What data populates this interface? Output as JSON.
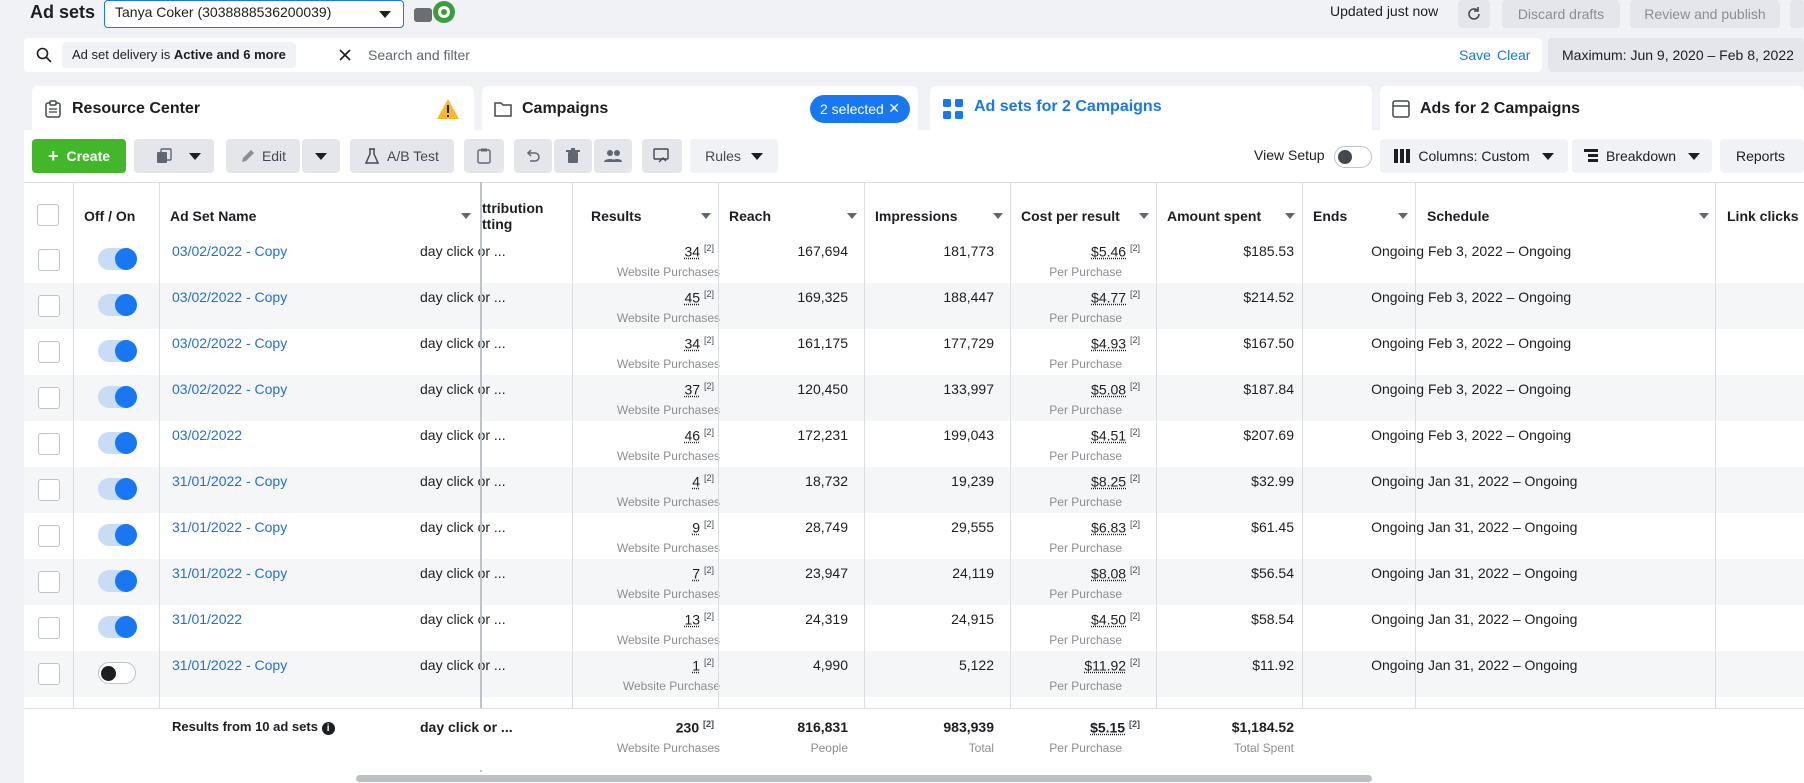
{
  "header": {
    "title": "Ad sets",
    "account": "Tanya Coker (3038888536200039)",
    "updated": "Updated just now",
    "discard": "Discard drafts",
    "review": "Review and publish"
  },
  "search": {
    "filter_chip_prefix": "Ad set delivery is ",
    "filter_chip_bold": "Active and 6 more",
    "placeholder": "Search and filter",
    "save": "Save",
    "clear": "Clear",
    "date_range": "Maximum: Jun 9, 2020 – Feb 8, 2022"
  },
  "tabs": {
    "resource": "Resource Center",
    "campaigns": "Campaigns",
    "selected": "2 selected",
    "adsets": "Ad sets for 2 Campaigns",
    "ads": "Ads for 2 Campaigns"
  },
  "toolbar": {
    "create": "Create",
    "edit": "Edit",
    "ab_test": "A/B Test",
    "rules": "Rules",
    "view_setup": "View Setup",
    "columns": "Columns: Custom",
    "breakdown": "Breakdown",
    "reports": "Reports"
  },
  "columns": {
    "off_on": "Off / On",
    "name": "Ad Set Name",
    "attribution": "ttribution",
    "attribution2": "tting",
    "results": "Results",
    "reach": "Reach",
    "impressions": "Impressions",
    "cpr": "Cost per result",
    "spent": "Amount spent",
    "ends": "Ends",
    "schedule": "Schedule",
    "link_clicks": "Link clicks"
  },
  "rows": [
    {
      "name": "03/02/2022 - Copy",
      "on": true,
      "attr": "day click or ...",
      "results": "34",
      "results_sub": "Website Purchases",
      "reach": "167,694",
      "impr": "181,773",
      "cpr": "$5.46",
      "cpr_sub": "Per Purchase",
      "spent": "$185.53",
      "ends": "Ongoing",
      "schedule": "Feb 3, 2022 – Ongoing"
    },
    {
      "name": "03/02/2022 - Copy",
      "on": true,
      "attr": "day click or ...",
      "results": "45",
      "results_sub": "Website Purchases",
      "reach": "169,325",
      "impr": "188,447",
      "cpr": "$4.77",
      "cpr_sub": "Per Purchase",
      "spent": "$214.52",
      "ends": "Ongoing",
      "schedule": "Feb 3, 2022 – Ongoing"
    },
    {
      "name": "03/02/2022 - Copy",
      "on": true,
      "attr": "day click or ...",
      "results": "34",
      "results_sub": "Website Purchases",
      "reach": "161,175",
      "impr": "177,729",
      "cpr": "$4.93",
      "cpr_sub": "Per Purchase",
      "spent": "$167.50",
      "ends": "Ongoing",
      "schedule": "Feb 3, 2022 – Ongoing"
    },
    {
      "name": "03/02/2022 - Copy",
      "on": true,
      "attr": "day click or ...",
      "results": "37",
      "results_sub": "Website Purchases",
      "reach": "120,450",
      "impr": "133,997",
      "cpr": "$5.08",
      "cpr_sub": "Per Purchase",
      "spent": "$187.84",
      "ends": "Ongoing",
      "schedule": "Feb 3, 2022 – Ongoing"
    },
    {
      "name": "03/02/2022",
      "on": true,
      "attr": "day click or ...",
      "results": "46",
      "results_sub": "Website Purchases",
      "reach": "172,231",
      "impr": "199,043",
      "cpr": "$4.51",
      "cpr_sub": "Per Purchase",
      "spent": "$207.69",
      "ends": "Ongoing",
      "schedule": "Feb 3, 2022 – Ongoing"
    },
    {
      "name": "31/01/2022 - Copy",
      "on": true,
      "attr": "day click or ...",
      "results": "4",
      "results_sub": "Website Purchases",
      "reach": "18,732",
      "impr": "19,239",
      "cpr": "$8.25",
      "cpr_sub": "Per Purchase",
      "spent": "$32.99",
      "ends": "Ongoing",
      "schedule": "Jan 31, 2022 – Ongoing"
    },
    {
      "name": "31/01/2022 - Copy",
      "on": true,
      "attr": "day click or ...",
      "results": "9",
      "results_sub": "Website Purchases",
      "reach": "28,749",
      "impr": "29,555",
      "cpr": "$6.83",
      "cpr_sub": "Per Purchase",
      "spent": "$61.45",
      "ends": "Ongoing",
      "schedule": "Jan 31, 2022 – Ongoing"
    },
    {
      "name": "31/01/2022 - Copy",
      "on": true,
      "attr": "day click or ...",
      "results": "7",
      "results_sub": "Website Purchases",
      "reach": "23,947",
      "impr": "24,119",
      "cpr": "$8.08",
      "cpr_sub": "Per Purchase",
      "spent": "$56.54",
      "ends": "Ongoing",
      "schedule": "Jan 31, 2022 – Ongoing"
    },
    {
      "name": "31/01/2022",
      "on": true,
      "attr": "day click or ...",
      "results": "13",
      "results_sub": "Website Purchases",
      "reach": "24,319",
      "impr": "24,915",
      "cpr": "$4.50",
      "cpr_sub": "Per Purchase",
      "spent": "$58.54",
      "ends": "Ongoing",
      "schedule": "Jan 31, 2022 – Ongoing"
    },
    {
      "name": "31/01/2022 - Copy",
      "on": false,
      "attr": "day click or ...",
      "results": "1",
      "results_sub": "Website Purchase",
      "reach": "4,990",
      "impr": "5,122",
      "cpr": "$11.92",
      "cpr_sub": "Per Purchase",
      "spent": "$11.92",
      "ends": "Ongoing",
      "schedule": "Jan 31, 2022 – Ongoing"
    }
  ],
  "footer": {
    "label": "Results from 10 ad sets",
    "attr": "day click or ...",
    "results": "230",
    "results_sub": "Website Purchases",
    "reach": "816,831",
    "reach_sub": "People",
    "impr": "983,939",
    "impr_sub": "Total",
    "cpr": "$5.15",
    "cpr_sub": "Per Purchase",
    "spent": "$1,184.52",
    "spent_sub": "Total Spent"
  },
  "superscript": "[2]",
  "colors": {
    "accent": "#1877f2",
    "create": "#42b72a",
    "link": "#216fdb"
  }
}
